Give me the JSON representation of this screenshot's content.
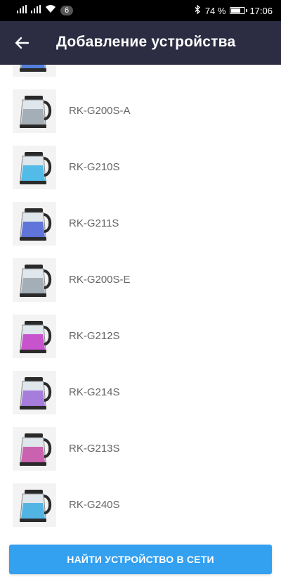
{
  "status_bar": {
    "notification_count": "6",
    "battery_percent": "74 %",
    "battery_level": 0.74,
    "time": "17:06",
    "icons": [
      "signal-icon",
      "signal-icon",
      "wifi-icon",
      "bluetooth-icon",
      "battery-icon"
    ]
  },
  "app_bar": {
    "title": "Добавление устройства",
    "back_icon": "arrow-left-icon",
    "background": "#2c2c42"
  },
  "devices": [
    {
      "label": "",
      "liquid_color": "#3b6fd8",
      "partial": true
    },
    {
      "label": "RK-G200S-A",
      "liquid_color": "#9aa3ad"
    },
    {
      "label": "RK-G210S",
      "liquid_color": "#3ab3e8"
    },
    {
      "label": "RK-G211S",
      "liquid_color": "#4a5fd6"
    },
    {
      "label": "RK-G200S-E",
      "liquid_color": "#9aa3ad"
    },
    {
      "label": "RK-G212S",
      "liquid_color": "#c43ac8"
    },
    {
      "label": "RK-G214S",
      "liquid_color": "#9c6ad8"
    },
    {
      "label": "RK-G213S",
      "liquid_color": "#c84aa6"
    },
    {
      "label": "RK-G240S",
      "liquid_color": "#3aaae0"
    }
  ],
  "footer": {
    "find_button_label": "НАЙТИ УСТРОЙСТВО В СЕТИ",
    "button_color": "#33a0f0"
  }
}
